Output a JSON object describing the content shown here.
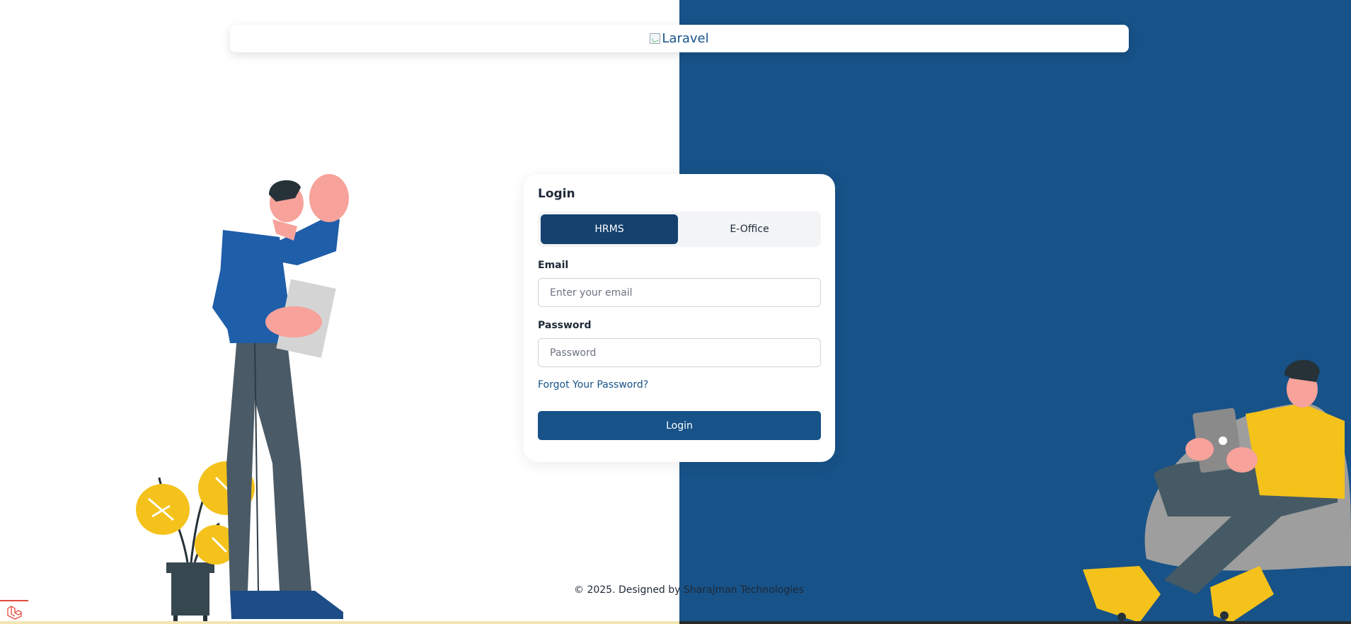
{
  "header": {
    "logo_alt": "Laravel"
  },
  "login_card": {
    "title": "Login",
    "tabs": [
      {
        "label": "HRMS",
        "active": true
      },
      {
        "label": "E-Office",
        "active": false
      }
    ],
    "email": {
      "label": "Email",
      "placeholder": "Enter your email",
      "value": ""
    },
    "password": {
      "label": "Password",
      "placeholder": "Password",
      "value": ""
    },
    "forgot_link": "Forgot Your Password?",
    "submit_label": "Login"
  },
  "footer": {
    "text": "© 2025. Designed by Sharajman Technologies"
  },
  "colors": {
    "primary": "#175288",
    "active_tab": "#14416e",
    "background_left": "#ffffff",
    "background_right": "#175288"
  }
}
